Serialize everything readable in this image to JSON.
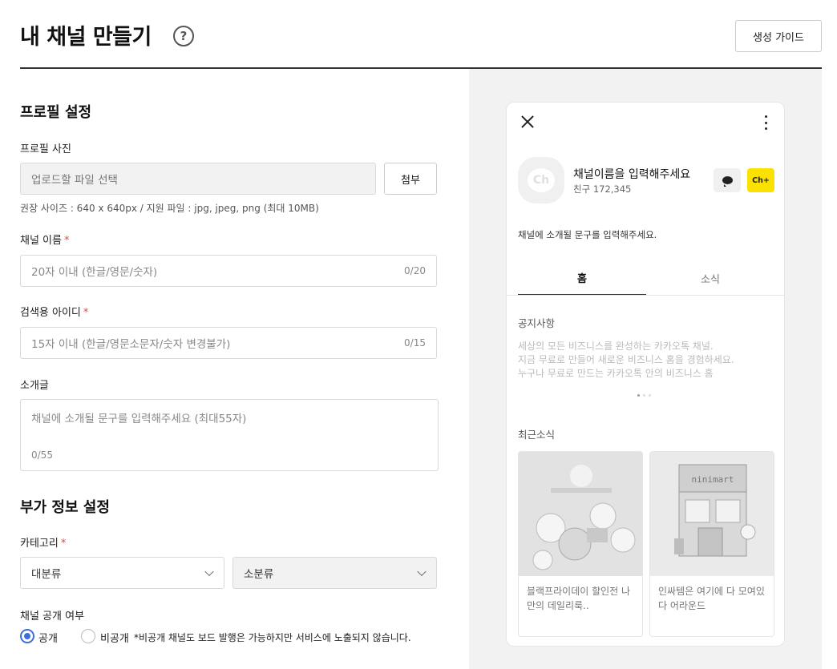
{
  "header": {
    "title": "내 채널 만들기",
    "help_icon": "question-circle-icon",
    "guide_button": "생성 가이드"
  },
  "profile": {
    "section_title": "프로필 설정",
    "photo_label": "프로필 사진",
    "photo_placeholder": "업로드할 파일 선택",
    "attach_button": "첨부",
    "photo_hint": "권장 사이즈 : 640 x 640px / 지원 파일 : jpg, jpeg, png (최대 10MB)",
    "name_label": "채널 이름",
    "name_placeholder": "20자 이내 (한글/영문/숫자)",
    "name_count": "0/20",
    "id_label": "검색용 아이디",
    "id_placeholder": "15자 이내 (한글/영문소문자/숫자 변경불가)",
    "id_count": "0/15",
    "intro_label": "소개글",
    "intro_placeholder": "채널에 소개될 문구를 입력해주세요 (최대55자)",
    "intro_count": "0/55",
    "required_mark": "*"
  },
  "extra": {
    "section_title": "부가 정보 설정",
    "category_label": "카테고리",
    "major_select": "대분류",
    "minor_select": "소분류",
    "visibility_label": "채널 공개 여부",
    "public_label": "공개",
    "private_label": "비공개",
    "private_note": "*비공개 채널도 보드 발행은 가능하지만 서비스에 노출되지 않습니다."
  },
  "preview": {
    "avatar_text": "Ch",
    "channel_name": "채널이름을 입력해주세요",
    "friends": "친구 172,345",
    "plus_label": "Ch+",
    "intro": "채널에 소개될 문구를 입력해주세요.",
    "tab_home": "홈",
    "tab_news": "소식",
    "notice_title": "공지사항",
    "notice_lines": [
      "세상의 모든 비즈니스를 완성하는 카카오톡 채널.",
      "지금 무료로 만들어 새로운 비즈니스 홈을 경험하세요.",
      "누구나 무료로 만드는 카카오톡 안의 비즈니스 홈"
    ],
    "news_title": "최근소식",
    "news": [
      {
        "caption": "블랙프라이데이 할인전 나만의 데일리룩.."
      },
      {
        "caption": "인싸템은 여기에 다 모여있다 어라운드",
        "sign": "ninimart"
      }
    ]
  }
}
